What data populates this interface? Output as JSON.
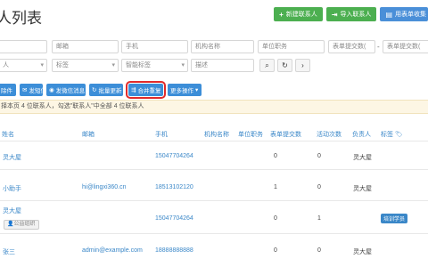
{
  "page": {
    "title": "人列表"
  },
  "top_buttons": {
    "new_contact": "新建联系人",
    "import_contact": "导入联系人",
    "form_collection": "用表单收集"
  },
  "filters": {
    "row1": [
      "",
      "邮箱",
      "手机",
      "机构名称",
      "单位职务",
      "表单提交数(",
      "-",
      "表单提交数("
    ],
    "row2": [
      "人",
      "标签",
      "智能标签",
      "描述"
    ]
  },
  "actions": {
    "delete": "除件",
    "sms": "发短信",
    "wechat": "发微信消息",
    "batch_update": "批量更新",
    "merge": "合并重复",
    "more": "更多操作"
  },
  "notice": "择本页 4 位联系人，勾选\"联系人\"中全部 4 位联系人",
  "table": {
    "headers": {
      "name": "姓名",
      "email": "邮箱",
      "phone": "手机",
      "org": "机构名称",
      "position": "单位职务",
      "forms": "表单提交数",
      "activities": "活动次数",
      "owner": "负责人",
      "tags": "标签"
    },
    "rows": [
      {
        "name": "灵大屋",
        "email": "",
        "phone": "15047704264",
        "forms": "0",
        "activities": "0",
        "owner": "灵大屋",
        "tag": "",
        "public": ""
      },
      {
        "name": "小助手",
        "email": "hi@lingxi360.cn",
        "phone": "18513102120",
        "forms": "1",
        "activities": "0",
        "owner": "灵大屋",
        "tag": "",
        "public": ""
      },
      {
        "name": "灵大屋",
        "email": "",
        "phone": "15047704264",
        "forms": "0",
        "activities": "1",
        "owner": "",
        "tag": "培训学员",
        "public": "公益组织"
      },
      {
        "name": "张三",
        "email": "admin@example.com",
        "phone": "18888888888",
        "forms": "0",
        "activities": "0",
        "owner": "灵大屋",
        "tag": "",
        "public": ""
      }
    ]
  }
}
